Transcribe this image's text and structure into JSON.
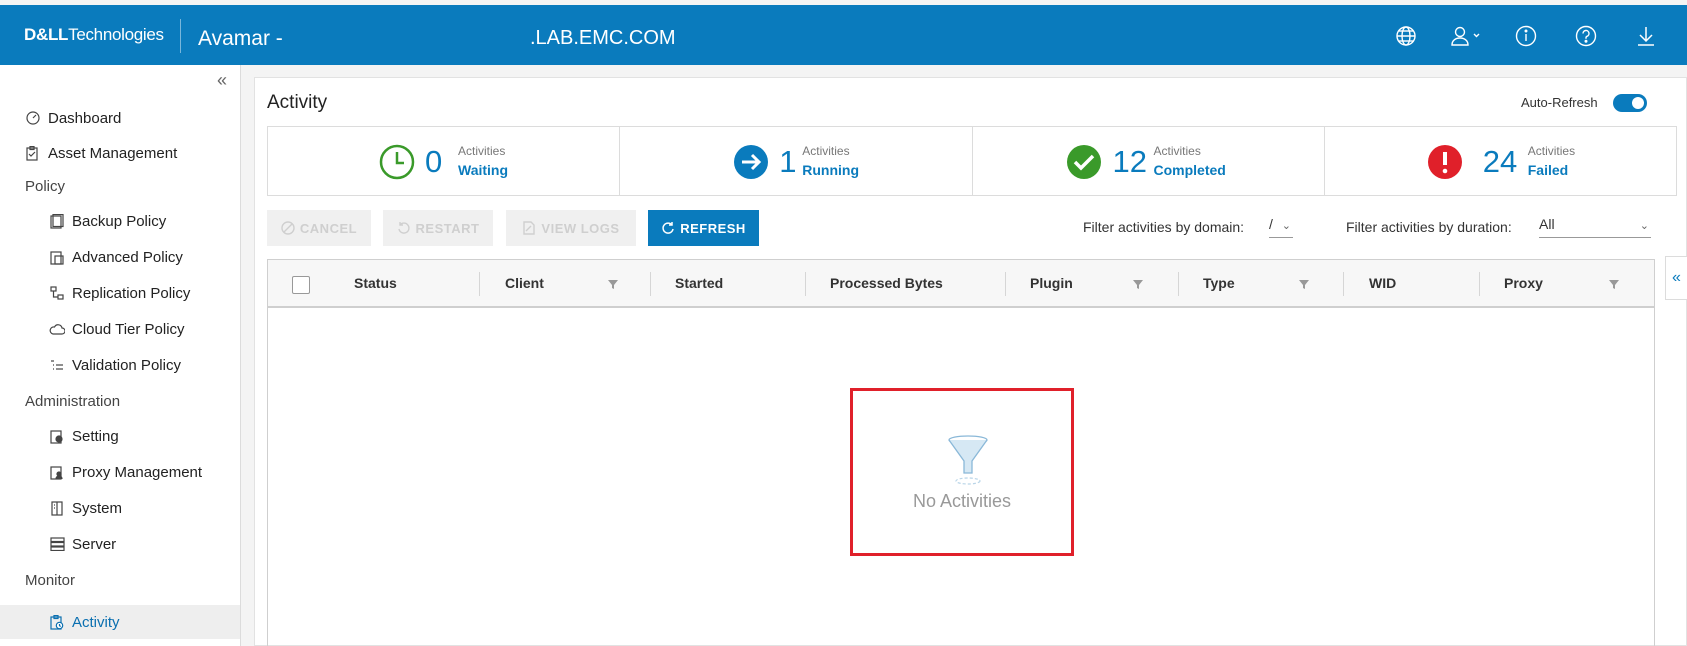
{
  "header": {
    "logo_dell": "D&LL",
    "logo_tech": "Technologies",
    "app_title": "Avamar -",
    "hostname": ".LAB.EMC.COM",
    "icons": [
      "globe-icon",
      "user-icon",
      "info-icon",
      "help-icon",
      "download-icon"
    ]
  },
  "sidebar": {
    "dashboard": "Dashboard",
    "asset_management": "Asset Management",
    "policy_group": "Policy",
    "backup_policy": "Backup Policy",
    "advanced_policy": "Advanced Policy",
    "replication_policy": "Replication Policy",
    "cloud_tier_policy": "Cloud Tier Policy",
    "validation_policy": "Validation Policy",
    "admin_group": "Administration",
    "setting": "Setting",
    "proxy_management": "Proxy Management",
    "system": "System",
    "server": "Server",
    "monitor_group": "Monitor",
    "activity": "Activity"
  },
  "main": {
    "title": "Activity",
    "auto_refresh_label": "Auto-Refresh",
    "auto_refresh_on": true,
    "stats": {
      "waiting": {
        "count": "0",
        "label1": "Activities",
        "label2": "Waiting",
        "color": "#3a9a2a"
      },
      "running": {
        "count": "1",
        "label1": "Activities",
        "label2": "Running",
        "color": "#0a7bbd"
      },
      "completed": {
        "count": "12",
        "label1": "Activities",
        "label2": "Completed",
        "color": "#3a9a2a"
      },
      "failed": {
        "count": "24",
        "label1": "Activities",
        "label2": "Failed",
        "color": "#e0202a"
      }
    },
    "buttons": {
      "cancel": "CANCEL",
      "restart": "RESTART",
      "view_logs": "VIEW LOGS",
      "refresh": "REFRESH"
    },
    "filters": {
      "domain_label": "Filter activities by domain:",
      "domain_value": "/",
      "duration_label": "Filter activities by duration:",
      "duration_value": "All"
    },
    "columns": {
      "status": "Status",
      "client": "Client",
      "started": "Started",
      "processed_bytes": "Processed Bytes",
      "plugin": "Plugin",
      "type": "Type",
      "wid": "WID",
      "proxy": "Proxy"
    },
    "empty_text": "No Activities"
  },
  "colors": {
    "brand": "#0a7bbd",
    "highlight": "#e0202a"
  }
}
